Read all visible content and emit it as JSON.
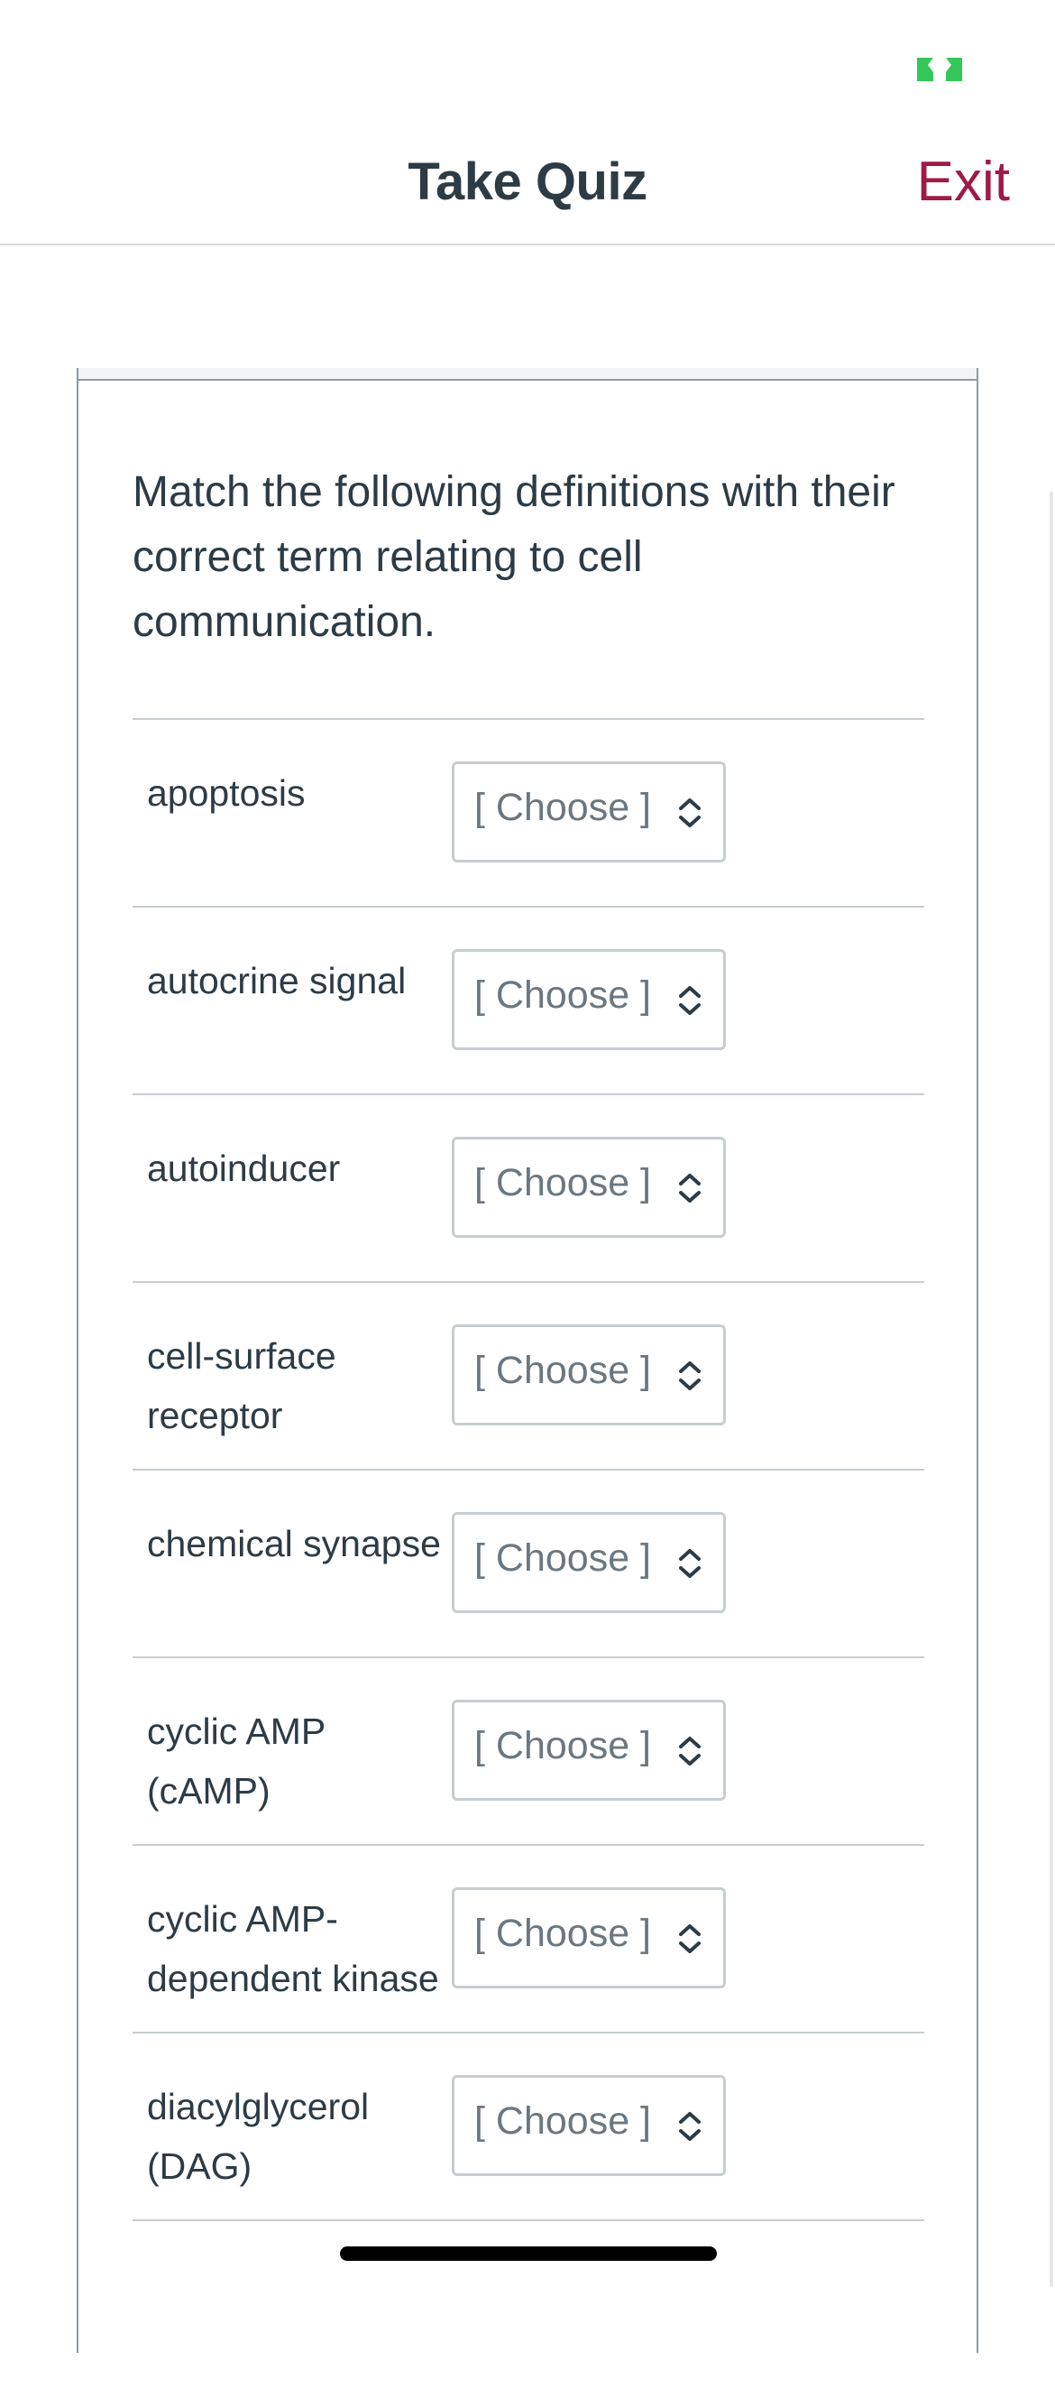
{
  "header": {
    "title": "Take Quiz",
    "exit_label": "Exit"
  },
  "colors": {
    "accent": "#9e1a47",
    "status_green": "#34c759",
    "text": "#2d3b45",
    "border": "#c7cdd1"
  },
  "question": {
    "text": "Match the following definitions with their correct term relating to cell communication."
  },
  "matches": [
    {
      "term": "apoptosis",
      "selected": "[ Choose ]"
    },
    {
      "term": "autocrine signal",
      "selected": "[ Choose ]"
    },
    {
      "term": "autoinducer",
      "selected": "[ Choose ]"
    },
    {
      "term": "cell-surface receptor",
      "selected": "[ Choose ]"
    },
    {
      "term": "chemical synapse",
      "selected": "[ Choose ]"
    },
    {
      "term": "cyclic AMP (cAMP)",
      "selected": "[ Choose ]"
    },
    {
      "term": "cyclic AMP-dependent kinase",
      "selected": "[ Choose ]"
    },
    {
      "term": "diacylglycerol (DAG)",
      "selected": "[ Choose ]"
    }
  ]
}
